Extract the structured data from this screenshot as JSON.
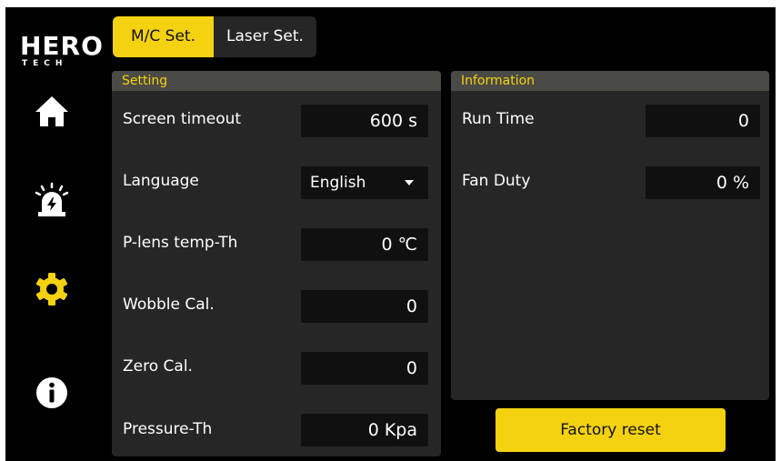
{
  "brand": {
    "line1": "HERO",
    "line2": "TECH"
  },
  "sidebar": {
    "icons": [
      "home-icon",
      "alarm-icon",
      "gear-icon",
      "info-icon"
    ],
    "active": "gear-icon",
    "active_color": "#f5d20f"
  },
  "tabs": [
    {
      "label": "M/C Set.",
      "active": true
    },
    {
      "label": "Laser Set.",
      "active": false
    }
  ],
  "setting": {
    "title": "Setting",
    "rows": [
      {
        "label": "Screen timeout",
        "value": "600 s"
      },
      {
        "label": "Language",
        "value": "English"
      },
      {
        "label": "P-lens temp-Th",
        "value": "0 ℃"
      },
      {
        "label": "Wobble Cal.",
        "value": "0"
      },
      {
        "label": "Zero Cal.",
        "value": "0"
      },
      {
        "label": "Pressure-Th",
        "value": "0 Kpa"
      }
    ]
  },
  "information": {
    "title": "Information",
    "rows": [
      {
        "label": "Run Time",
        "value": "0"
      },
      {
        "label": "Fan Duty",
        "value": "0 %"
      }
    ]
  },
  "factory_reset_label": "Factory reset",
  "colors": {
    "accent": "#f5d20f",
    "panel": "#262626",
    "background": "#000000"
  }
}
